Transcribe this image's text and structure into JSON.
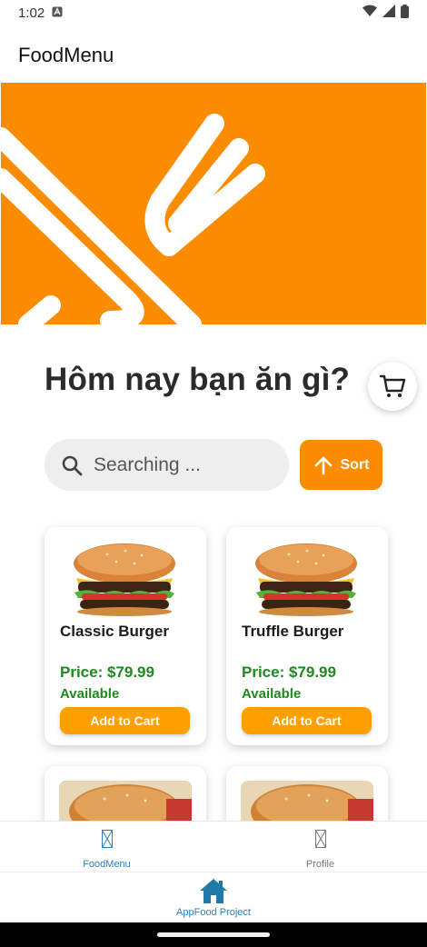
{
  "status_bar": {
    "time": "1:02"
  },
  "app_bar": {
    "title": "FoodMenu"
  },
  "headline": "Hôm nay bạn ăn gì?",
  "search": {
    "placeholder": "Searching ..."
  },
  "sort_button": {
    "label": "Sort"
  },
  "products": [
    {
      "name": "Classic Burger",
      "price": "Price: $79.99",
      "status": "Available",
      "button": "Add to Cart"
    },
    {
      "name": "Truffle Burger",
      "price": "Price: $79.99",
      "status": "Available",
      "button": "Add to Cart"
    }
  ],
  "tabs": [
    {
      "label": "FoodMenu",
      "active": true
    },
    {
      "label": "Profile",
      "active": false
    }
  ],
  "bottom_nav": {
    "label": "AppFood Project"
  },
  "colors": {
    "accent": "#fb8c00",
    "button": "#ffa000",
    "price": "#1e8a1e",
    "tab_active": "#2a7fc0"
  },
  "icons": [
    "app-notification-icon",
    "wifi-icon",
    "signal-icon",
    "battery-icon",
    "fork-knife-icon",
    "cart-icon",
    "search-icon",
    "arrow-up-icon",
    "home-icon"
  ]
}
